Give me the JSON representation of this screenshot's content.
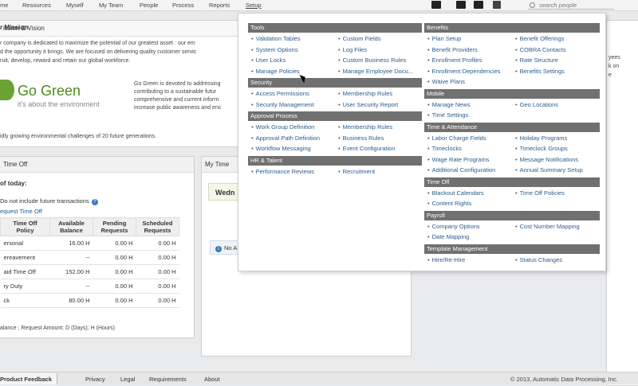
{
  "topnav": {
    "items": [
      "me",
      "Resources",
      "Myself",
      "My Team",
      "People",
      "Process",
      "Reports",
      "Setup"
    ],
    "search_placeholder": "search people"
  },
  "mission": {
    "panel_title": "ission & Vision",
    "heading": "r Mission",
    "text_lines": [
      "r company is dedicated to maximize the potential of our greatest asset : our em",
      "d the opportunity it brings. We are focused on delivering quality customer servic",
      "ruit, develop, reward and retain our global workforce."
    ],
    "logo_name": "Go Green",
    "logo_tagline": "it's about the environment",
    "desc_lines": [
      "Go Green is devoted to addressing",
      "contributing to a sustainable futur",
      "comprehensive and current inform",
      "increase public awareness and enc"
    ],
    "footer_line": "idly growing environmental challenges of 20 future generations."
  },
  "timeoff": {
    "panel_title": "Time Off",
    "as_of": "of today:",
    "exclude_label": "Do not include future transactions",
    "request_link": "equest Time Off",
    "columns": [
      "Time Off Policy",
      "Available Balance",
      "Pending Requests",
      "Scheduled Requests"
    ],
    "rows": [
      [
        "ersonal",
        "16.00 H",
        "0.00 H",
        "0.00 H"
      ],
      [
        "ereavement",
        "--",
        "0.00 H",
        "0.00 H"
      ],
      [
        "aid Time Off",
        "152.00 H",
        "0.00 H",
        "0.00 H"
      ],
      [
        "ry Duty",
        "--",
        "0.00 H",
        "0.00 H"
      ],
      [
        "ck",
        "80.00 H",
        "0.00 H",
        "0.00 H"
      ]
    ],
    "note": "alance ; Request Amount: D (Days); H (Hours)"
  },
  "mytime": {
    "panel_title": "My Time",
    "day": "Wedn",
    "note": "No A"
  },
  "right_col": {
    "lines": [
      "yees",
      "k on",
      "e"
    ]
  },
  "dropdown": {
    "left_sections": [
      {
        "title": "Tools",
        "items": [
          "Validation Tables",
          "Custom Fields",
          "System Options",
          "Log Files",
          "User Locks",
          "Custom Business Rules",
          "Manage Policies",
          "Manage Employee Docu..."
        ]
      },
      {
        "title": "Security",
        "items": [
          "Access Permissions",
          "Membership Rules",
          "Security Management",
          "User Security Report"
        ]
      },
      {
        "title": "Approval Process",
        "items": [
          "Work Group Definition",
          "Membership Rules",
          "Approval Path Definition",
          "Business Rules",
          "Workflow Messaging",
          "Event Configuration"
        ]
      },
      {
        "title": "HR & Talent",
        "items": [
          "Performance Reviews",
          "Recruitment"
        ]
      }
    ],
    "right_sections": [
      {
        "title": "Benefits",
        "items": [
          "Plan Setup",
          "Benefit Offerings",
          "Benefit Providers",
          "COBRA Contacts",
          "Enrollment Profiles",
          "Rate Structure",
          "Enrollment Dependencies",
          "Benefits Settings",
          "Waive Plans"
        ]
      },
      {
        "title": "Mobile",
        "items": [
          "Manage News",
          "Geo Locations",
          "Time Settings"
        ]
      },
      {
        "title": "Time & Attendance",
        "items": [
          "Labor Charge Fields",
          "Holiday Programs",
          "Timeclocks",
          "Timeclock Groups",
          "Wage Rate Programs",
          "Message Notifications",
          "Additional Configuration",
          "Annual Summary Setup"
        ]
      },
      {
        "title": "Time Off",
        "items": [
          "Blackout Calendars",
          "Time Off Policies",
          "Content Rights"
        ]
      },
      {
        "title": "Payroll",
        "items": [
          "Company Options",
          "Cost Number Mapping",
          "Date Mapping"
        ]
      },
      {
        "title": "Template Management",
        "items": [
          "Hire/Re-Hire",
          "Status Changes"
        ]
      }
    ]
  },
  "footer": {
    "feedback": "Product Feedback",
    "links": [
      "Privacy",
      "Legal",
      "Requirements",
      "About"
    ],
    "copyright": "© 2013, Automatic Data Processing, Inc."
  }
}
